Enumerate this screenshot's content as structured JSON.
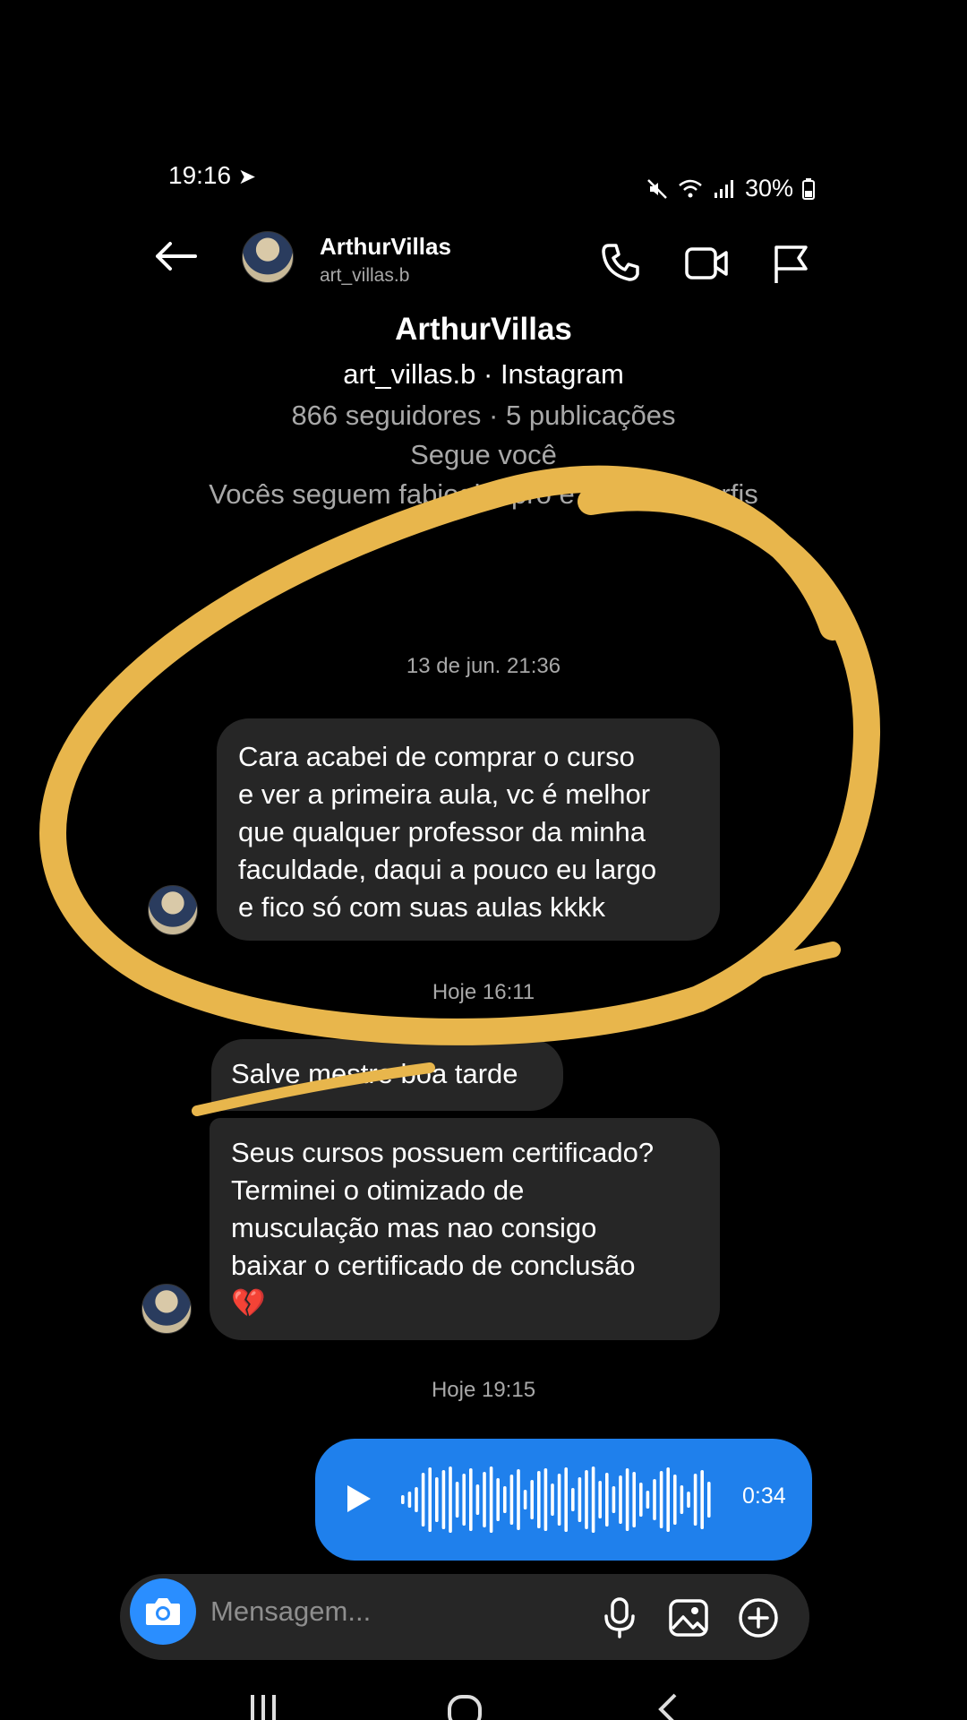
{
  "status_bar": {
    "time": "19:16",
    "battery": "30%"
  },
  "header": {
    "name": "ArthurVillas",
    "handle": "art_villas.b",
    "back_icon": "arrow-left-icon",
    "actions": [
      "phone-icon",
      "video-icon",
      "flag-icon"
    ]
  },
  "profile": {
    "name": "ArthurVillas",
    "subtitle": "art_villas.b · Instagram",
    "stats": "866 seguidores · 5 publicações",
    "follows_you": "Segue você",
    "mutuals": "Vocês seguem fabiogigapro e outros 7 perfis"
  },
  "messages": {
    "ts1": "13 de jun. 21:36",
    "m1": [
      "Cara acabei de comprar o curso",
      "e ver a primeira aula, vc é melhor",
      "que qualquer professor da minha",
      "faculdade, daqui a pouco eu largo",
      "e fico só com suas aulas kkkk"
    ],
    "ts2": "Hoje 16:11",
    "m2": "Salve mestre boa tarde",
    "m3": [
      "Seus cursos possuem certificado?",
      "Terminei o otimizado de",
      "musculação mas nao consigo",
      "baixar o certificado de conclusão",
      "💔"
    ],
    "ts3": "Hoje 19:15",
    "voice": {
      "duration": "0:34"
    }
  },
  "composer": {
    "placeholder": "Mensagem..."
  },
  "colors": {
    "accent_blue": "#1f80ec",
    "bubble": "#262626",
    "annotation": "#e8b64c"
  }
}
